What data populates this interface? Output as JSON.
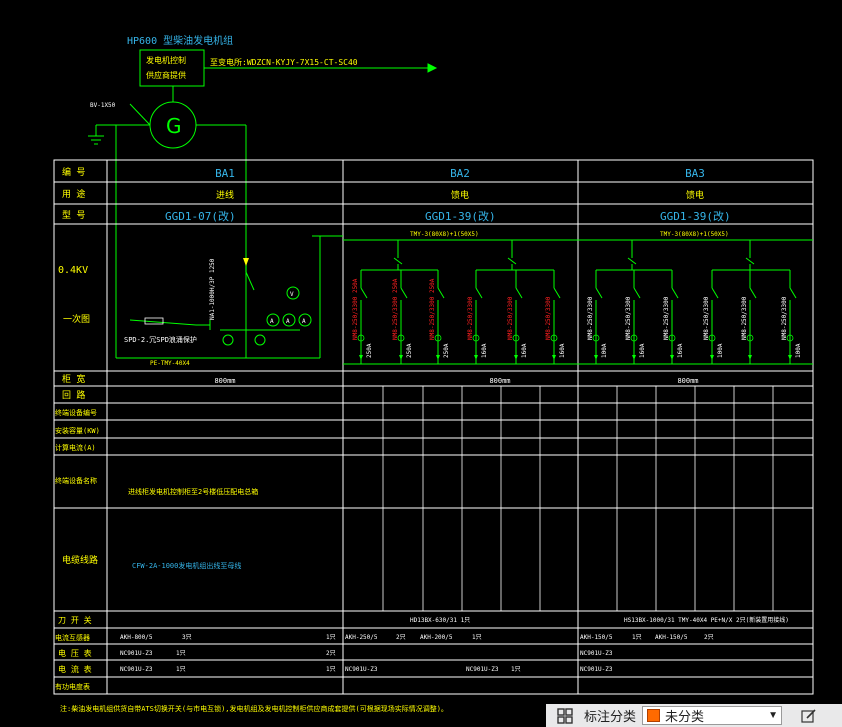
{
  "generator": {
    "model": "HP600 型柴油发电机组",
    "panel_line1": "发电机控制",
    "panel_line2": "供应商提供",
    "cable": "至变电所:WDZCN-KYJY-7X15-CT-SC40",
    "ground": "BV-1X50",
    "symbol": "G"
  },
  "row_labels": {
    "number": "编  号",
    "usage": "用  途",
    "model": "型  号",
    "voltage": "0.4KV",
    "one_line": "一次图",
    "cabinet_width": "柜  宽",
    "circuit": "回  路",
    "terminal_no": "终端设备编号",
    "installed_capacity": "安装容量(KW)",
    "calc_current": "计算电流(A)",
    "terminal_name": "终端设备名称",
    "cable_line": "电缆线路",
    "knife_switch": "刀 开 关",
    "current_transformer": "电流互感器",
    "voltmeter": "电 压 表",
    "ammeter": "电 流 表",
    "power_meter": "有功电度表"
  },
  "panels": [
    {
      "id": "BA1",
      "usage": "进线",
      "model": "GGD1-07(改)",
      "width": "800mm"
    },
    {
      "id": "BA2",
      "usage": "馈电",
      "model": "GGD1-39(改)",
      "width": "800mm"
    },
    {
      "id": "BA3",
      "usage": "馈电",
      "model": "GGD1-39(改)",
      "width": "800mm"
    }
  ],
  "ba1_detail": {
    "spd": "SPD-2.冗SPD浪涌保护",
    "breaker": "NA1-1000H/3P 1250",
    "pe_bus": "PE-TMY-40X4",
    "terminal_name": "进线柜发电机控制柜至2号楼低压配电总箱",
    "cable": "CFW-2A-1000发电机组出线至母线"
  },
  "bus_labels": {
    "ba2": "TMY-3(80X8)+1(50X5)",
    "ba3": "TMY-3(80X8)+1(50X5)"
  },
  "ba2_breakers": [
    "NM8-250/3300 250A",
    "NM8-250/3300 250A",
    "NM8-250/3300 250A",
    "NM8-250/3300",
    "NM8-250/3300",
    "NM8-250/3300"
  ],
  "ba2_ratings": [
    "250A",
    "250A",
    "250A",
    "160A",
    "160A",
    "160A"
  ],
  "ba3_breakers": [
    "NM8-250/3300",
    "NM8-250/3300",
    "NM8-250/3300",
    "NM8-250/3300",
    "NM8-250/3300",
    "NM8-250/3300"
  ],
  "ba3_ratings": [
    "100A",
    "160A",
    "160A",
    "100A",
    "",
    "100A"
  ],
  "bottom_rows": {
    "knife_ba2": "HD13BX-630/31    1只",
    "knife_ba3": "HS13BX-1000/31 TMY-40X4 PE+N/X 2只(新装置用接线)",
    "ct_ba1_a": "AKH-800/5",
    "ct_ba1_b": "3只",
    "ct_ba1_c": "1只",
    "ct_ba2_a": "AKH-250/5",
    "ct_ba2_b": "2只",
    "ct_ba2_c": "AKH-200/5",
    "ct_ba2_d": "1只",
    "ct_ba3_a": "AKH-150/5",
    "ct_ba3_b": "1只",
    "ct_ba3_c": "AKH-150/5",
    "ct_ba3_d": "2只",
    "vm_ba1": "NC901U-Z3",
    "vm_ba1_b": "1只",
    "vm_ba1_c": "2只",
    "vm_ba3": "NC901U-Z3",
    "am_ba1": "NC901U-Z3",
    "am_ba1_b": "1只",
    "am_ba1_c": "1只",
    "am_ba2": "NC901U-Z3",
    "am_ba2_b": "NC901U-Z3",
    "am_ba2_c": "1只",
    "am_ba3": "NC901U-Z3"
  },
  "footnote": "注:柴油发电机组供货自带ATS切换开关(与市电互锁),发电机组及发电机控制柜供应商成套提供(可根据现场实际情况调整)。",
  "statusbar": {
    "label": "标注分类",
    "selected": "未分类",
    "accent": "#ff6a00"
  },
  "colors": {
    "line": "#00ff00",
    "text_yellow": "#ffff00",
    "text_white": "#ffffff",
    "text_red": "#ff2020",
    "text_cyan": "#35b4e8"
  }
}
